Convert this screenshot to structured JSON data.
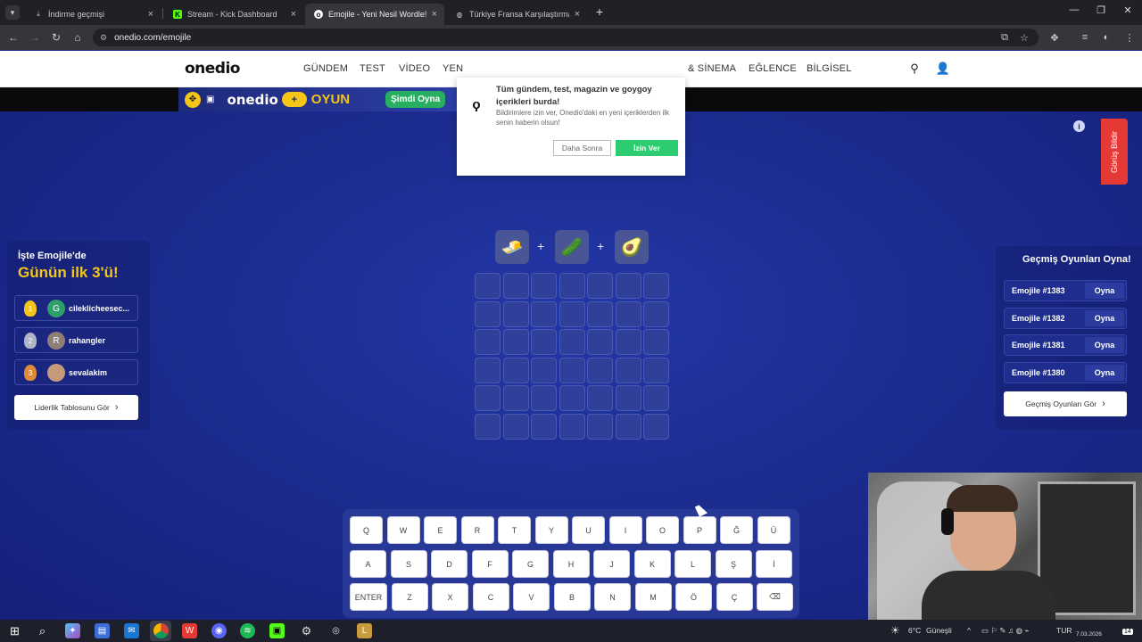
{
  "browser": {
    "tabs": [
      {
        "title": "İndirme geçmişi",
        "icon": "download-icon"
      },
      {
        "title": "Stream - Kick Dashboard",
        "icon": "kick-icon"
      },
      {
        "title": "Emojile - Yeni Nesil Wordle!",
        "icon": "onedio-icon"
      },
      {
        "title": "Türkiye Fransa Karşılaştırması",
        "icon": "globe-icon"
      }
    ],
    "url": "onedio.com/emojile"
  },
  "site": {
    "logo": "onedio",
    "nav": [
      "GÜNDEM",
      "TEST",
      "VİDEO",
      "YEN",
      "& SİNEMA",
      "EĞLENCE",
      "BİLGİSEL"
    ]
  },
  "banner": {
    "logo": "onedio",
    "plus": "+",
    "oyun": "OYUN",
    "play": "Şimdi Oyna"
  },
  "popup": {
    "title": "Tüm gündem, test, magazin ve goygoy içerikleri burda!",
    "body": "Bildirimlere izin ver, Onedio'daki en yeni içeriklerden ilk senin haberin olsun!",
    "later": "Daha Sonra",
    "allow": "İzin Ver"
  },
  "feedback": "Görüş Bildir",
  "clue": {
    "emojis": [
      "🧈",
      "🥒",
      "🥑"
    ],
    "plus": "+"
  },
  "grid": {
    "rows": 6,
    "cols": 7
  },
  "keyboard": {
    "row1": [
      "Q",
      "W",
      "E",
      "R",
      "T",
      "Y",
      "U",
      "I",
      "O",
      "P",
      "Ğ",
      "Ü"
    ],
    "row2": [
      "A",
      "S",
      "D",
      "F",
      "G",
      "H",
      "J",
      "K",
      "L",
      "Ş",
      "İ"
    ],
    "row3": [
      "ENTER",
      "Z",
      "X",
      "C",
      "V",
      "B",
      "N",
      "M",
      "Ö",
      "Ç",
      "⌫"
    ]
  },
  "leaderboard": {
    "subtitle": "İşte Emojile'de",
    "title": "Günün ilk 3'ü!",
    "entries": [
      {
        "rank": "1",
        "initial": "G",
        "name": "cileklicheesec...",
        "medal_color": "#f5c518",
        "avatar_color": "#2e9e6b"
      },
      {
        "rank": "2",
        "initial": "R",
        "name": "rahangler",
        "medal_color": "#b0b4c8",
        "avatar_color": "#8d7f77"
      },
      {
        "rank": "3",
        "initial": "",
        "name": "sevalakim",
        "medal_color": "#e08a3c",
        "avatar_color": "#c49a7a"
      }
    ],
    "button": "Liderlik Tablosunu Gör"
  },
  "past_games": {
    "title": "Geçmiş Oyunları Oyna!",
    "items": [
      {
        "name": "Emojile #1383",
        "action": "Oyna"
      },
      {
        "name": "Emojile #1382",
        "action": "Oyna"
      },
      {
        "name": "Emojile #1381",
        "action": "Oyna"
      },
      {
        "name": "Emojile #1380",
        "action": "Oyna"
      }
    ],
    "button": "Geçmiş Oyunları Gör"
  },
  "taskbar": {
    "weather": "6°C",
    "weather_desc": "Güneşli",
    "lang": "TUR",
    "date": "7.03.2026",
    "notif_count": "14"
  },
  "colors": {
    "accent_green": "#2ecc71",
    "brand_yellow": "#f5c518",
    "feedback_red": "#e53935",
    "page_bg": "#1c2c90"
  }
}
